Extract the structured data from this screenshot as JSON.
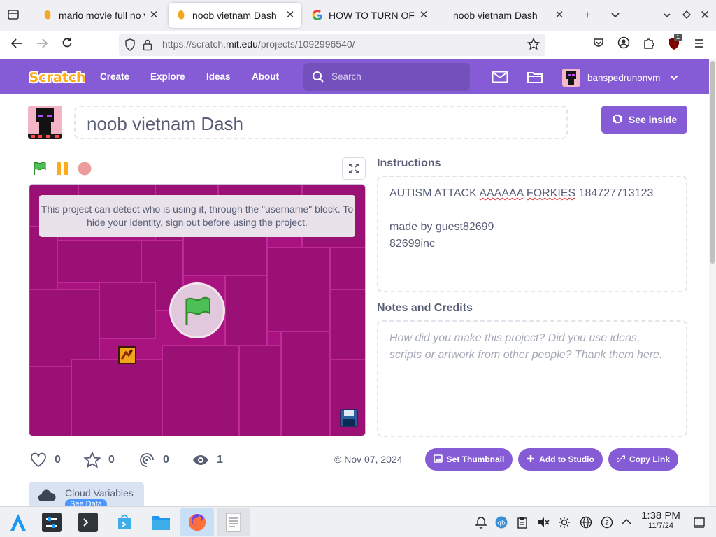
{
  "browser": {
    "tabs": [
      {
        "label": "mario movie full no v",
        "favicon": "scratch-cat-icon",
        "active": false
      },
      {
        "label": "noob vietnam Dash o",
        "favicon": "scratch-cat-icon",
        "active": true
      },
      {
        "label": "HOW TO TURN OFF C",
        "favicon": "google-icon",
        "active": false
      },
      {
        "label": "noob vietnam Dash",
        "favicon": "none",
        "active": false
      }
    ],
    "url_prefix": "https://scratch.",
    "url_domain": "mit.edu",
    "url_path": "/projects/1092996540/",
    "extension_badge": "1"
  },
  "scratch_header": {
    "logo": "Scratch",
    "links": [
      "Create",
      "Explore",
      "Ideas",
      "About"
    ],
    "search_placeholder": "Search",
    "username": "banspedrunonvm"
  },
  "project": {
    "title": "noob vietnam Dash",
    "see_inside_label": "See inside",
    "stage_notice": "This project can detect who is using it, through the \"username\" block. To hide your identity, sign out before using the project.",
    "instructions_heading": "Instructions",
    "instructions": {
      "line1_a": "AUTISM ATTACK ",
      "line1_b": "AAAAAA",
      "line1_c": " ",
      "line1_d": "FORKIES",
      "line1_e": " 184727713123",
      "line2": "made by guest82699",
      "line3": "82699inc"
    },
    "notes_heading": "Notes and Credits",
    "notes_placeholder": "How did you make this project? Did you use ideas, scripts or artwork from other people? Thank them here.",
    "stats": {
      "loves": "0",
      "favorites": "0",
      "remixes": "0",
      "views": "1"
    },
    "date": "Nov 07, 2024",
    "date_prefix": "©",
    "buttons": {
      "set_thumbnail": "Set Thumbnail",
      "add_to_studio": "Add to Studio",
      "copy_link": "Copy Link"
    },
    "cloud": {
      "label": "Cloud Variables",
      "pill": "See Data"
    }
  },
  "taskbar": {
    "time": "1:38 PM",
    "date": "11/7/24"
  },
  "colors": {
    "scratch_purple": "#855cd6",
    "stage_magenta": "#b0168a",
    "text_grey": "#575e75"
  }
}
